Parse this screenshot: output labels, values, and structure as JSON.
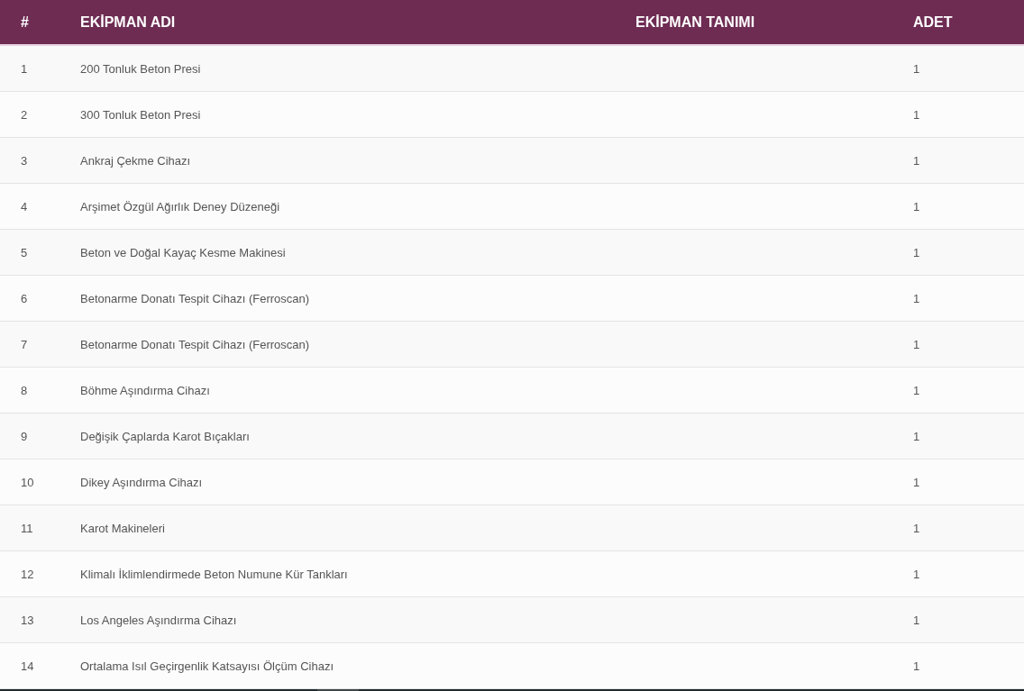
{
  "table": {
    "columns": [
      "#",
      "EKİPMAN ADI",
      "EKİPMAN TANIMI",
      "ADET"
    ],
    "rows": [
      {
        "no": "1",
        "name": "200 Tonluk Beton Presi",
        "count": "1"
      },
      {
        "no": "2",
        "name": "300 Tonluk Beton Presi",
        "count": "1"
      },
      {
        "no": "3",
        "name": "Ankraj Çekme Cihazı",
        "count": "1"
      },
      {
        "no": "4",
        "name": "Arşimet Özgül Ağırlık Deney Düzeneği",
        "count": "1"
      },
      {
        "no": "5",
        "name": "Beton ve Doğal Kayaç Kesme Makinesi",
        "count": "1"
      },
      {
        "no": "6",
        "name": "Betonarme Donatı Tespit Cihazı (Ferroscan)",
        "count": "1"
      },
      {
        "no": "7",
        "name": "Betonarme Donatı Tespit Cihazı (Ferroscan)",
        "count": "1"
      },
      {
        "no": "8",
        "name": "Böhme Aşındırma Cihazı",
        "count": "1"
      },
      {
        "no": "9",
        "name": "Değişik Çaplarda Karot Bıçakları",
        "count": "1"
      },
      {
        "no": "10",
        "name": "Dikey Aşındırma Cihazı",
        "count": "1"
      },
      {
        "no": "11",
        "name": "Karot Makineleri",
        "count": "1"
      },
      {
        "no": "12",
        "name": "Klimalı İklimlendirmede Beton Numune Kür Tankları",
        "count": "1"
      },
      {
        "no": "13",
        "name": "Los Angeles Aşındırma Cihazı",
        "count": "1"
      },
      {
        "no": "14",
        "name": "Ortalama Isıl Geçirgenlik Katsayısı Ölçüm Cihazı",
        "count": "1"
      }
    ]
  }
}
